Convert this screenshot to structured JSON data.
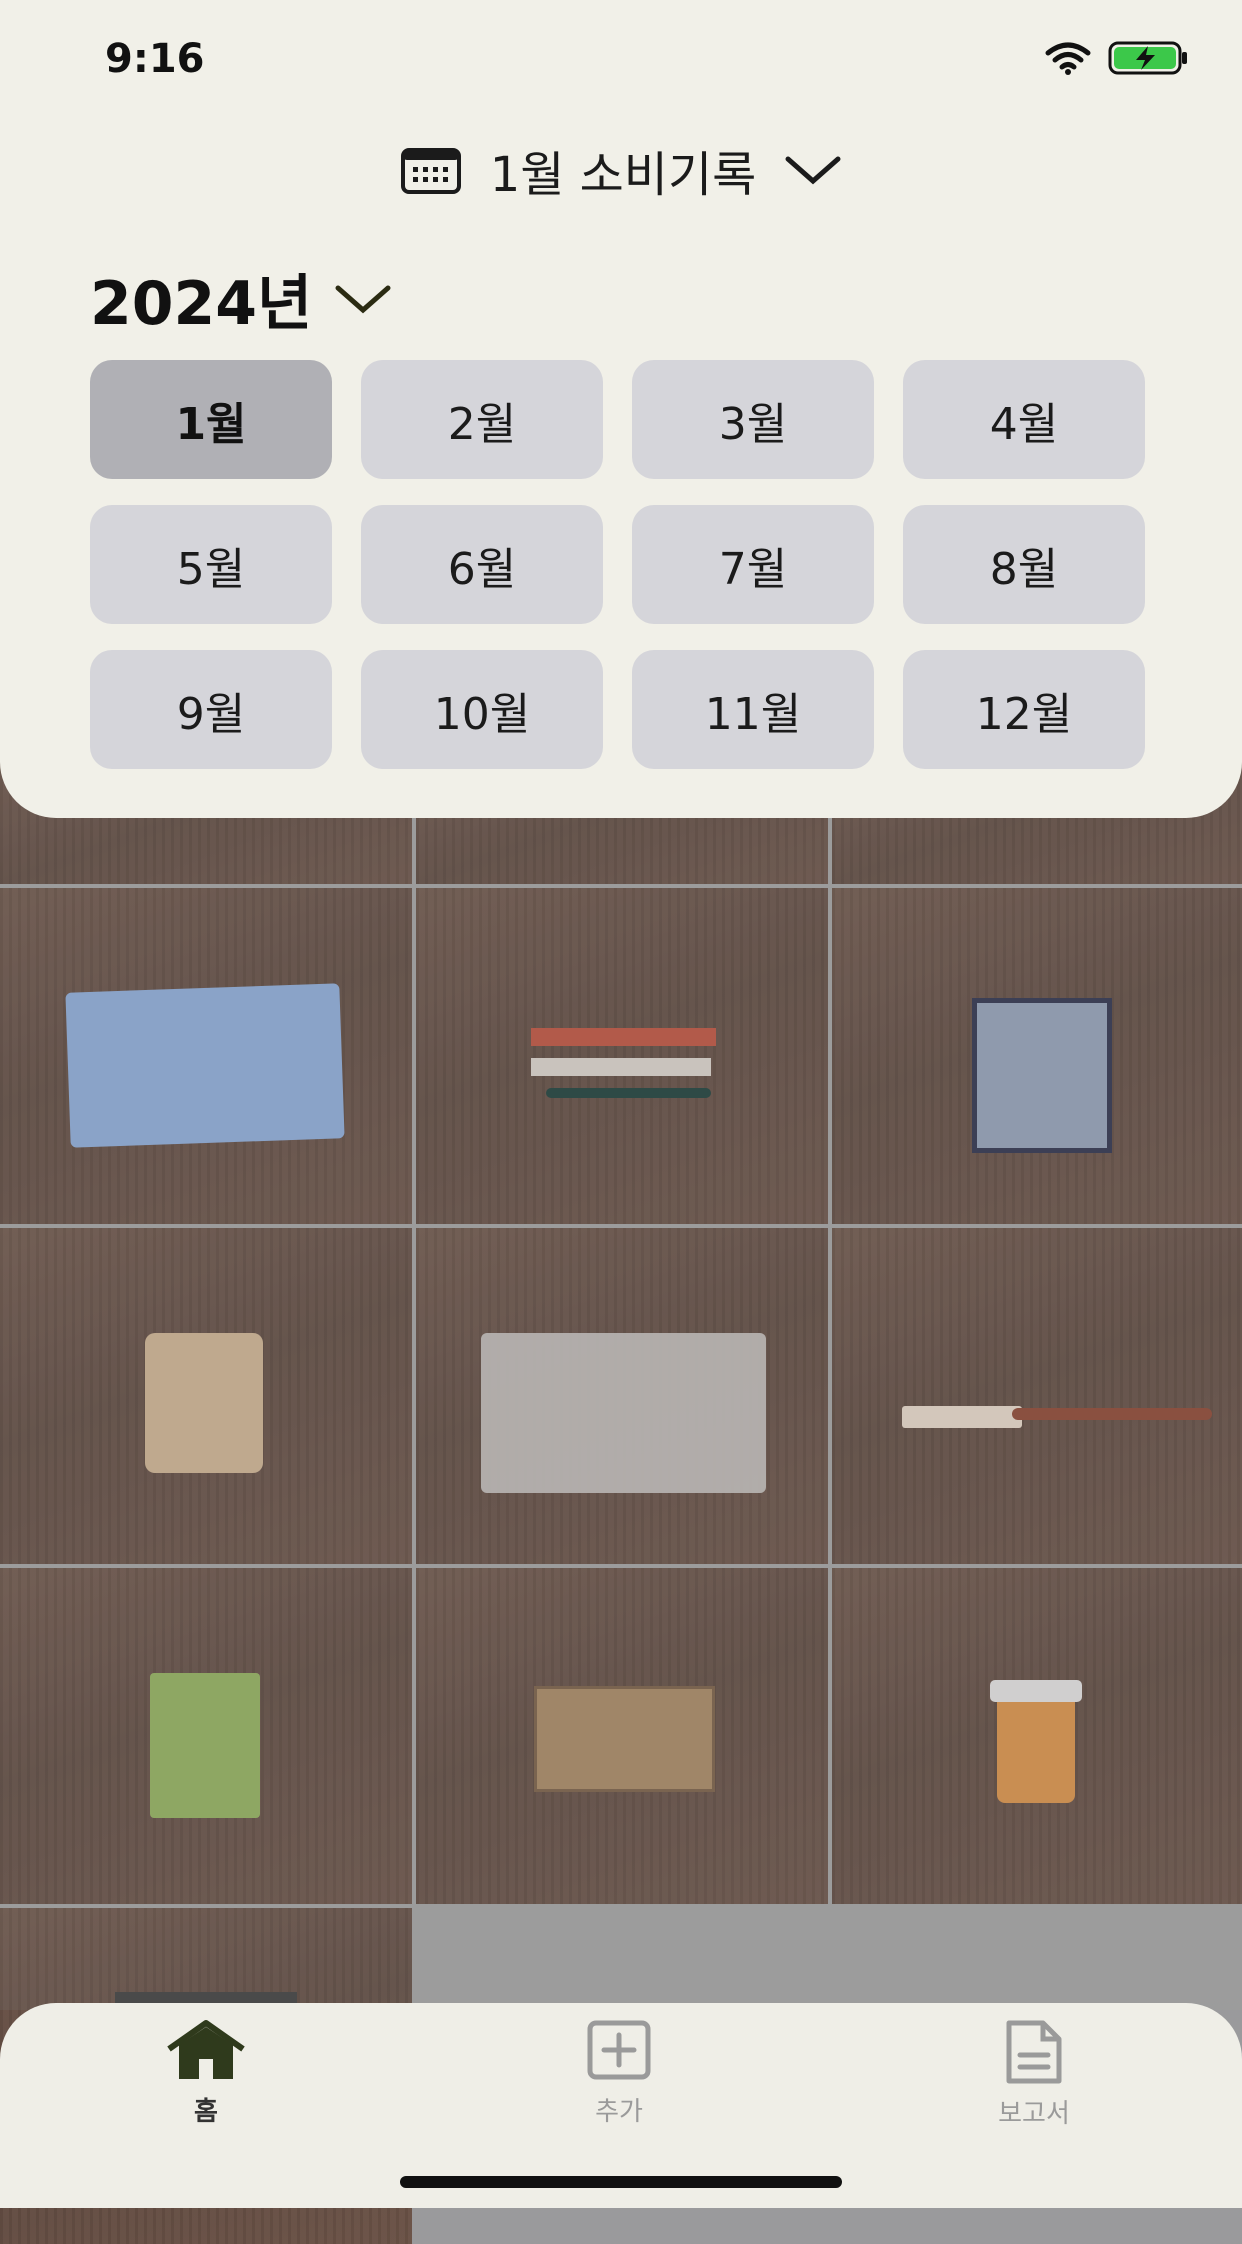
{
  "status_bar": {
    "time": "9:16",
    "icons": [
      "wifi-icon",
      "battery-charging-icon"
    ]
  },
  "header": {
    "title": "1월 소비기록",
    "calendar_icon": "calendar-icon",
    "chevron_icon": "chevron-down-icon"
  },
  "year_picker": {
    "label": "2024년",
    "chevron_icon": "chevron-down-icon"
  },
  "months": {
    "selected": "1월",
    "items": [
      "1월",
      "2월",
      "3월",
      "4월",
      "5월",
      "6월",
      "7월",
      "8월",
      "9월",
      "10월",
      "11월",
      "12월"
    ]
  },
  "grid": {
    "items": [
      "pencil-case",
      "pencil-set",
      "mini-rug",
      "leather-wallet",
      "zip-pouch",
      "brush",
      "notebook",
      "wooden-box",
      "pill-bottle",
      "pencils"
    ]
  },
  "tab_bar": {
    "tabs": [
      {
        "label": "홈",
        "icon": "home-icon",
        "active": true
      },
      {
        "label": "추가",
        "icon": "plus-square-icon",
        "active": false
      },
      {
        "label": "보고서",
        "icon": "report-icon",
        "active": false
      }
    ]
  },
  "colors": {
    "sheet_bg": "#f1f0e8",
    "chip_bg": "#d5d5da",
    "chip_selected": "#b0b0b5",
    "accent": "#2f3a1c"
  }
}
